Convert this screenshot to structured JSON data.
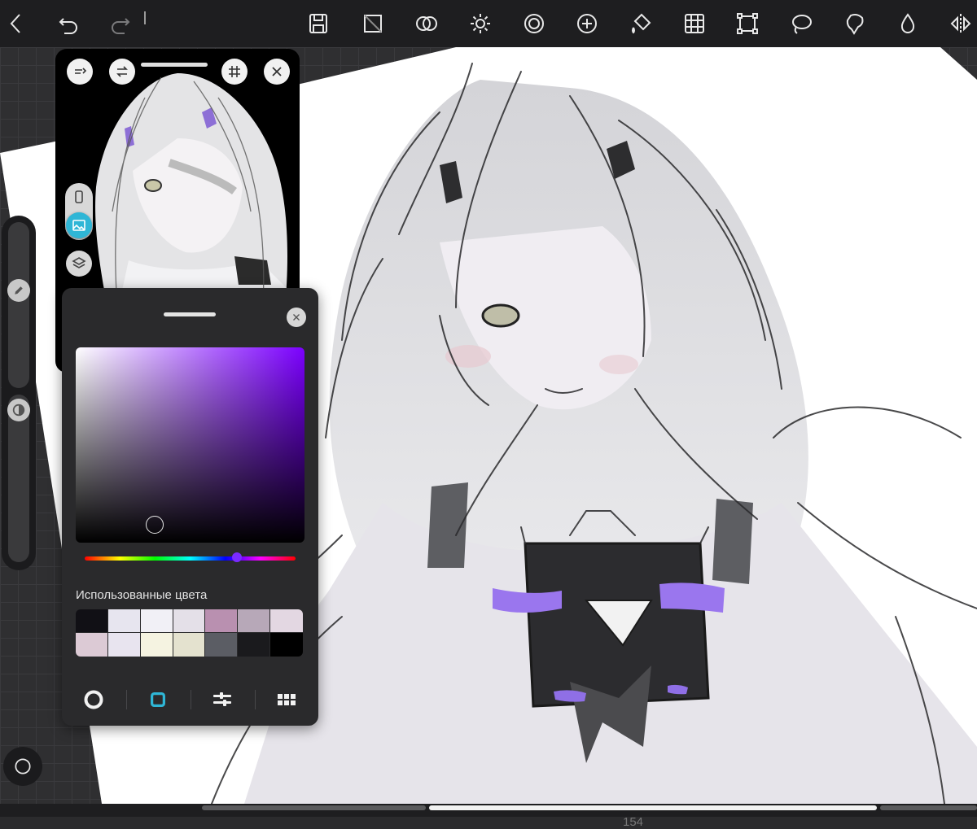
{
  "toolbar": {
    "icons": [
      "back-icon",
      "undo-icon",
      "redo-icon",
      "save-icon",
      "canvas-icon",
      "blend-icon",
      "brightness-icon",
      "filter-icon",
      "add-layer-icon",
      "fill-icon",
      "grid-icon",
      "transform-icon",
      "lasso-icon",
      "magic-wand-icon",
      "drop-icon",
      "mirror-icon"
    ]
  },
  "reference_panel": {
    "icons": [
      "exit-reference-icon",
      "flip-icon",
      "grid-icon",
      "close-icon",
      "device-icon",
      "image-icon",
      "layers-icon"
    ]
  },
  "color_panel": {
    "used_colors_label": "Использованные цвета",
    "hue_color": "#7b00ff",
    "swatches": [
      "#111015",
      "#e7e5ef",
      "#f1f0f6",
      "#e4e0e8",
      "#b990b0",
      "#b7a8b8",
      "#e3d7e2",
      "#dccad5",
      "#e8e4ef",
      "#f5f3e1",
      "#e4e2cf",
      "#5b5d64",
      "#1a1a1d",
      "#000000"
    ],
    "tabs": [
      "disc-tab-icon",
      "square-tab-icon",
      "sliders-tab-icon",
      "palette-tab-icon"
    ]
  },
  "canvas": {
    "page_indicator": "154"
  },
  "colors": {
    "accent": "#2fb6d6",
    "stroke_purple": "#9a76ee"
  }
}
